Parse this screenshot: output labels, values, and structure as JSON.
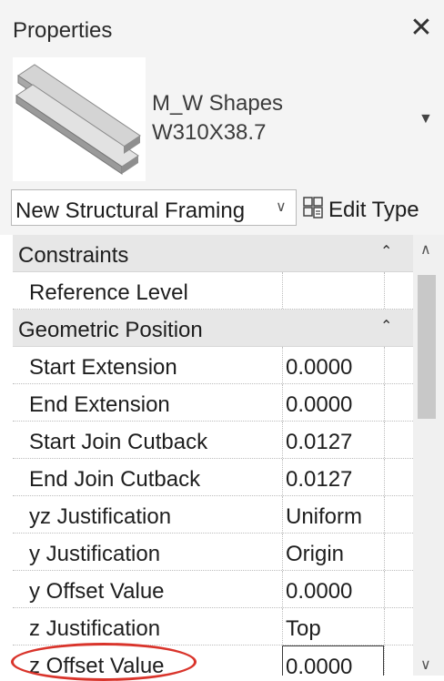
{
  "window": {
    "title": "Properties",
    "close_glyph": "✕"
  },
  "type_selector": {
    "family": "M_W Shapes",
    "type": "W310X38.7",
    "preview_icon": "i-beam-preview-icon",
    "dropdown_glyph": "▼"
  },
  "instance_filter": {
    "value": "New Structural Framing",
    "chevron_glyph": "∨"
  },
  "edit_type": {
    "label": "Edit Type",
    "icon": "edit-type-icon"
  },
  "groups": [
    {
      "label": "Constraints",
      "collapse_glyph": "⌃",
      "rows": [
        {
          "name": "Reference Level",
          "value": ""
        }
      ]
    },
    {
      "label": "Geometric Position",
      "collapse_glyph": "⌃",
      "rows": [
        {
          "name": "Start Extension",
          "value": "0.0000"
        },
        {
          "name": "End Extension",
          "value": "0.0000"
        },
        {
          "name": "Start Join Cutback",
          "value": "0.0127"
        },
        {
          "name": "End Join Cutback",
          "value": "0.0127"
        },
        {
          "name": "yz Justification",
          "value": "Uniform"
        },
        {
          "name": "y Justification",
          "value": "Origin"
        },
        {
          "name": "y Offset Value",
          "value": "0.0000"
        },
        {
          "name": "z Justification",
          "value": "Top"
        },
        {
          "name": "z Offset Value",
          "value": "0.0000"
        }
      ]
    }
  ],
  "scrollbar": {
    "up_glyph": "∧",
    "down_glyph": "∨"
  },
  "colors": {
    "highlight_ring": "#d9342b",
    "group_header": "#e7e7e7",
    "panel_bg": "#f4f4f4"
  }
}
